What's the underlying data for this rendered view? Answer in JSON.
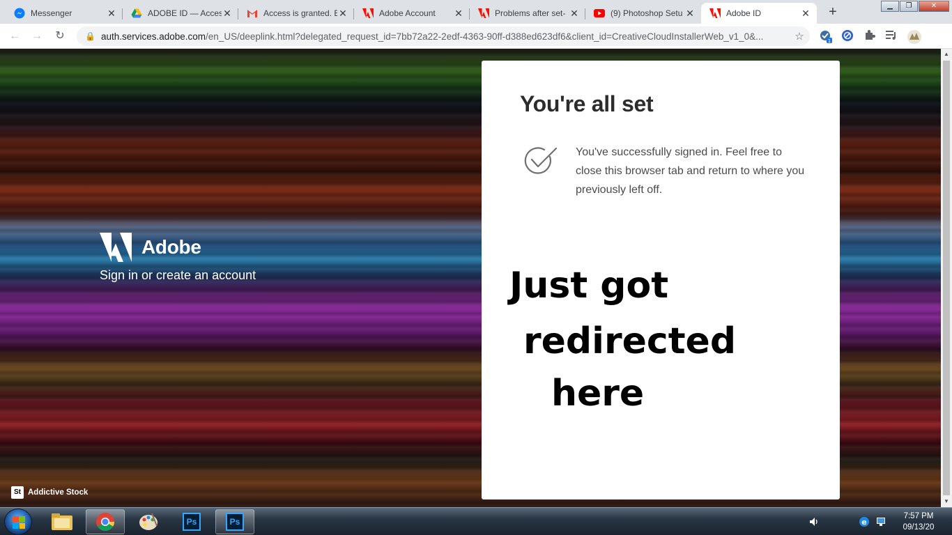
{
  "browser": {
    "tabs": [
      {
        "title": "Messenger",
        "icon": "messenger-icon",
        "active": false
      },
      {
        "title": "ADOBE ID — Acces",
        "icon": "google-drive-icon",
        "active": false
      },
      {
        "title": "Access is granted. E",
        "icon": "gmail-icon",
        "active": false
      },
      {
        "title": "Adobe Account",
        "icon": "adobe-icon",
        "active": false
      },
      {
        "title": "Problems after set-",
        "icon": "adobe-icon",
        "active": false
      },
      {
        "title": "(9) Photoshop Setu",
        "icon": "youtube-icon",
        "active": false
      },
      {
        "title": "Adobe ID",
        "icon": "adobe-icon",
        "active": true
      }
    ],
    "url_host": "auth.services.adobe.com",
    "url_path": "/en_US/deeplink.html?delegated_request_id=7bb72a22-2edf-4363-90ff-d388ed623df6&client_id=CreativeCloudInstallerWeb_v1_0&..."
  },
  "page": {
    "brand_name": "Adobe",
    "tagline": "Sign in or create an account",
    "stock_badge": "St",
    "stock_credit": "Addictive Stock",
    "card": {
      "title": "You're all set",
      "message": "You've successfully signed in. Feel free to close this browser tab and return to where you previously left off.",
      "handwritten_note": [
        "Just got",
        "redirected",
        "here"
      ]
    }
  },
  "taskbar": {
    "ps_label": "Ps",
    "time": "7:57 PM",
    "date": "09/13/20"
  },
  "colors": {
    "adobe_red": "#fa0f00",
    "chrome_tab_bg": "#dee1e6",
    "card_text": "#2c2c2c"
  }
}
